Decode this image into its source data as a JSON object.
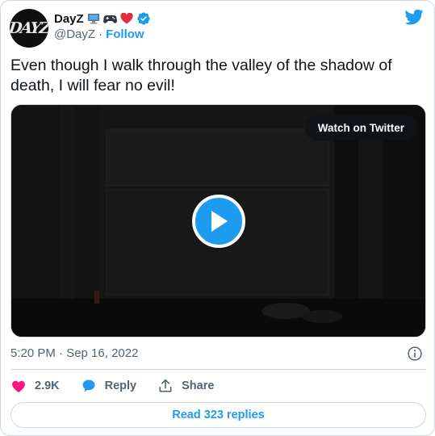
{
  "author": {
    "name": "DayZ",
    "handle": "@DayZ",
    "separator": "·",
    "follow_label": "Follow",
    "avatar_text": "DAYZ",
    "emojis": [
      "computer-emoji",
      "game-controller-emoji",
      "red-heart-emoji"
    ],
    "verified": true
  },
  "tweet": {
    "text": "Even though I walk through the valley of the shadow of death, I will fear no evil!",
    "timestamp": "5:20 PM · Sep 16, 2022"
  },
  "media": {
    "watch_label": "Watch on Twitter",
    "type": "video"
  },
  "actions": {
    "like_count": "2.9K",
    "reply_label": "Reply",
    "share_label": "Share"
  },
  "footer": {
    "read_replies_label": "Read 323 replies"
  },
  "colors": {
    "accent": "#1d9bf0",
    "like": "#f91880",
    "text": "#0f1419",
    "muted": "#536471",
    "border": "#cfd9de"
  }
}
